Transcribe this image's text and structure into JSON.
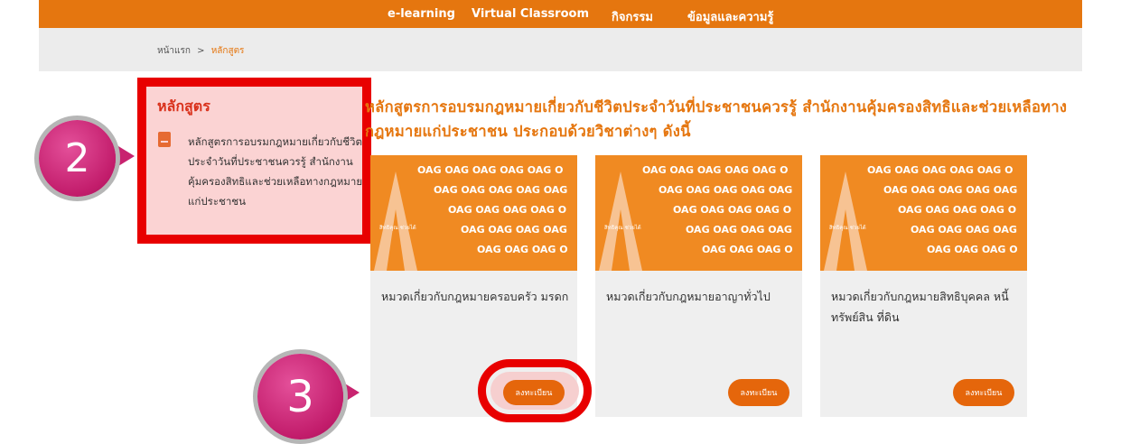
{
  "nav": {
    "items": [
      "e-learning",
      "Virtual Classroom",
      "กิจกรรม",
      "ข้อมูลและความรู้"
    ]
  },
  "breadcrumb": {
    "home": "หน้าแรก",
    "sep": ">",
    "current": "หลักสูตร"
  },
  "sidebar": {
    "title": "หลักสูตร",
    "item": "หลักสูตรการอบรมกฎหมายเกี่ยวกับชีวิตประจำวันที่ประชาชนควรรู้ สำนักงานคุ้มครองสิทธิและช่วยเหลือทางกฎหมายแก่ประชาชน",
    "item_icon": "book-icon"
  },
  "heading": "หลักสูตรการอบรมกฎหมายเกี่ยวกับชีวิตประจำวันที่ประชาชนควรรู้ สำนักงานคุ้มครองสิทธิและช่วยเหลือทางกฎหมายแก่ประชาชน ประกอบด้วยวิชาต่างๆ ดังนี้",
  "cards": [
    {
      "title": "หมวดเกี่ยวกับกฎหมายครอบครัว มรดก",
      "button": "ลงทะเบียน"
    },
    {
      "title": "หมวดเกี่ยวกับกฎหมายอาญาทั่วไป",
      "button": "ลงทะเบียน"
    },
    {
      "title": "หมวดเกี่ยวกับกฎหมายสิทธิบุคคล หนี้ ทรัพย์สิน ที่ดิน",
      "button": "ลงทะเบียน"
    }
  ],
  "card_image": {
    "logo_text": "OAG",
    "caption": "สิทธิคุณ ช่วยได้"
  },
  "badges": {
    "step2": "2",
    "step3": "3"
  },
  "colors": {
    "brand_orange": "#e5760f",
    "highlight_red": "#e80000",
    "badge_pink": "#c21c6b",
    "sidebar_bg": "#fbd3d3"
  }
}
